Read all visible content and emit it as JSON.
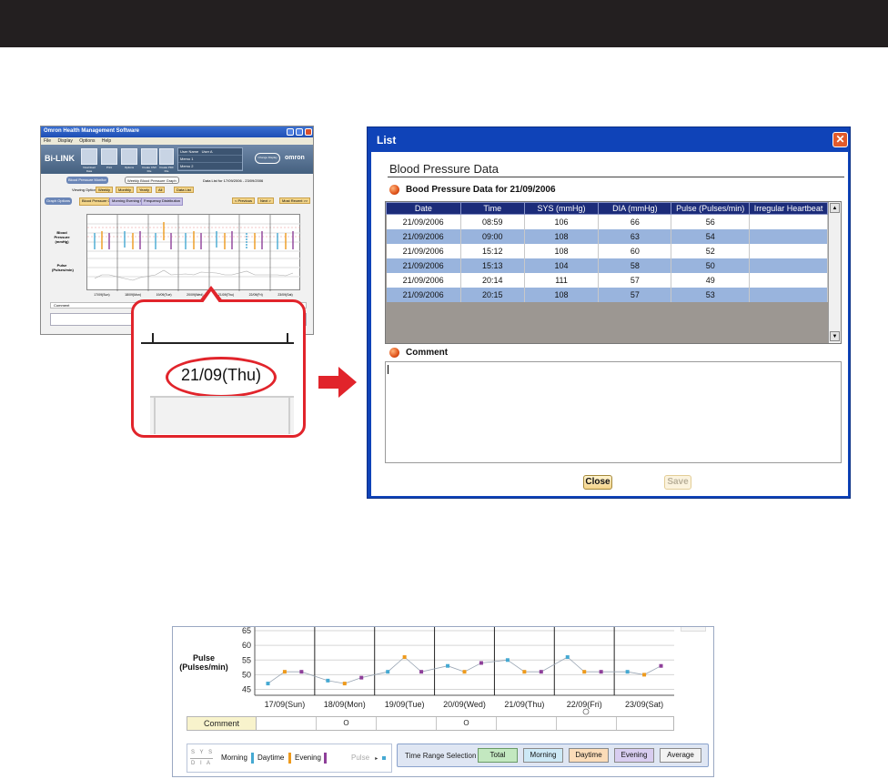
{
  "app_thumbnail": {
    "window_title": "Omron Health Management Software",
    "menu": [
      "File",
      "Display",
      "Options",
      "Help"
    ],
    "logo": "Bi-LINK",
    "toolbar": [
      "Download Data",
      "Print",
      "Options",
      "Create CSV File",
      "Create PDF File"
    ],
    "user_labels": [
      "User Name",
      "Memo 1",
      "Memo 2"
    ],
    "user_value": "User A",
    "change_button": "Change Display",
    "brand": "omron",
    "tabs": [
      "Blood Pressure Monitor",
      "Weekly Blood Pressure Graph"
    ],
    "data_list_label": "Data List for 17/09/2006 - 23/09/2006",
    "viewing_options": "Viewing Options",
    "period_buttons": [
      "Weekly",
      "Monthly",
      "Yearly",
      "All",
      "Data List"
    ],
    "graph_options": "Graph Options",
    "graph_buttons": [
      "Blood Pressure Graph",
      "Morning Evening Comparison",
      "Frequency Distribution"
    ],
    "nav_buttons": [
      "< Previous",
      "Next >",
      "Most Recent >>"
    ],
    "bp_label": "Blood Pressure (mmHg)",
    "pulse_label": "Pulse (Pulses/min)",
    "comment_label": "Comment",
    "dates": [
      "17/09(Sun)",
      "18/09(Mon)",
      "19/09(Tue)",
      "20/09(Wed)",
      "21/09(Thu)",
      "22/09(Fri)",
      "23/09(Sat)"
    ],
    "time_range_label": "Time Range Selection"
  },
  "callout": {
    "date": "21/09(Thu)"
  },
  "dialog": {
    "title": "List",
    "section_title": "Blood Pressure Data",
    "data_header": "Bood Pressure Data for 21/09/2006",
    "columns": [
      "Date",
      "Time",
      "SYS (mmHg)",
      "DIA (mmHg)",
      "Pulse (Pulses/min)",
      "Irregular Heartbeat"
    ],
    "rows": [
      [
        "21/09/2006",
        "08:59",
        "106",
        "66",
        "56",
        ""
      ],
      [
        "21/09/2006",
        "09:00",
        "108",
        "63",
        "54",
        ""
      ],
      [
        "21/09/2006",
        "15:12",
        "108",
        "60",
        "52",
        ""
      ],
      [
        "21/09/2006",
        "15:13",
        "104",
        "58",
        "50",
        ""
      ],
      [
        "21/09/2006",
        "20:14",
        "111",
        "57",
        "49",
        ""
      ],
      [
        "21/09/2006",
        "20:15",
        "108",
        "57",
        "53",
        ""
      ]
    ],
    "comment_label": "Comment",
    "comment_value": "",
    "close_label": "Close",
    "save_label": "Save",
    "close_icon": "close-icon",
    "orb_icon": "orange-bullet-icon"
  },
  "pulse_graph": {
    "ylabel": "Pulse\n(Pulses/min)",
    "comment_label": "Comment",
    "comment_marks": [
      "",
      "O",
      "",
      "O",
      "",
      "",
      ""
    ],
    "legend": {
      "sys": "S Y S",
      "dia": "D I A",
      "morning": "Morning",
      "daytime": "Daytime",
      "evening": "Evening",
      "pulse": "Pulse"
    },
    "time_range": {
      "label": "Time Range Selection",
      "buttons": [
        "Total",
        "Morning",
        "Daytime",
        "Evening",
        "Average"
      ],
      "selected": "Total"
    }
  },
  "colors": {
    "morning": "#45a9d2",
    "daytime": "#ee9a1c",
    "evening": "#8e3f99",
    "accent_red": "#e1242b",
    "dialog_blue": "#0f43b8",
    "table_header": "#1c2c7a",
    "row_highlight": "#99b4dd"
  },
  "chart_data": {
    "type": "line",
    "categories": [
      "17/09(Sun)",
      "18/09(Mon)",
      "19/09(Tue)",
      "20/09(Wed)",
      "21/09(Thu)",
      "22/09(Fri)",
      "23/09(Sat)"
    ],
    "yticks": [
      45,
      50,
      55,
      60,
      65
    ],
    "ylim": [
      43,
      65
    ],
    "ylabel": "Pulse\n(Pulses/min)",
    "grid": true,
    "series": [
      {
        "name": "Morning",
        "color": "#45a9d2",
        "values": [
          47,
          48,
          51,
          53,
          55,
          56,
          51
        ]
      },
      {
        "name": "Daytime",
        "color": "#ee9a1c",
        "values": [
          51,
          47,
          56,
          51,
          51,
          51,
          50
        ]
      },
      {
        "name": "Evening",
        "color": "#8e3f99",
        "values": [
          51,
          49,
          51,
          54,
          51,
          51,
          53
        ]
      }
    ]
  }
}
